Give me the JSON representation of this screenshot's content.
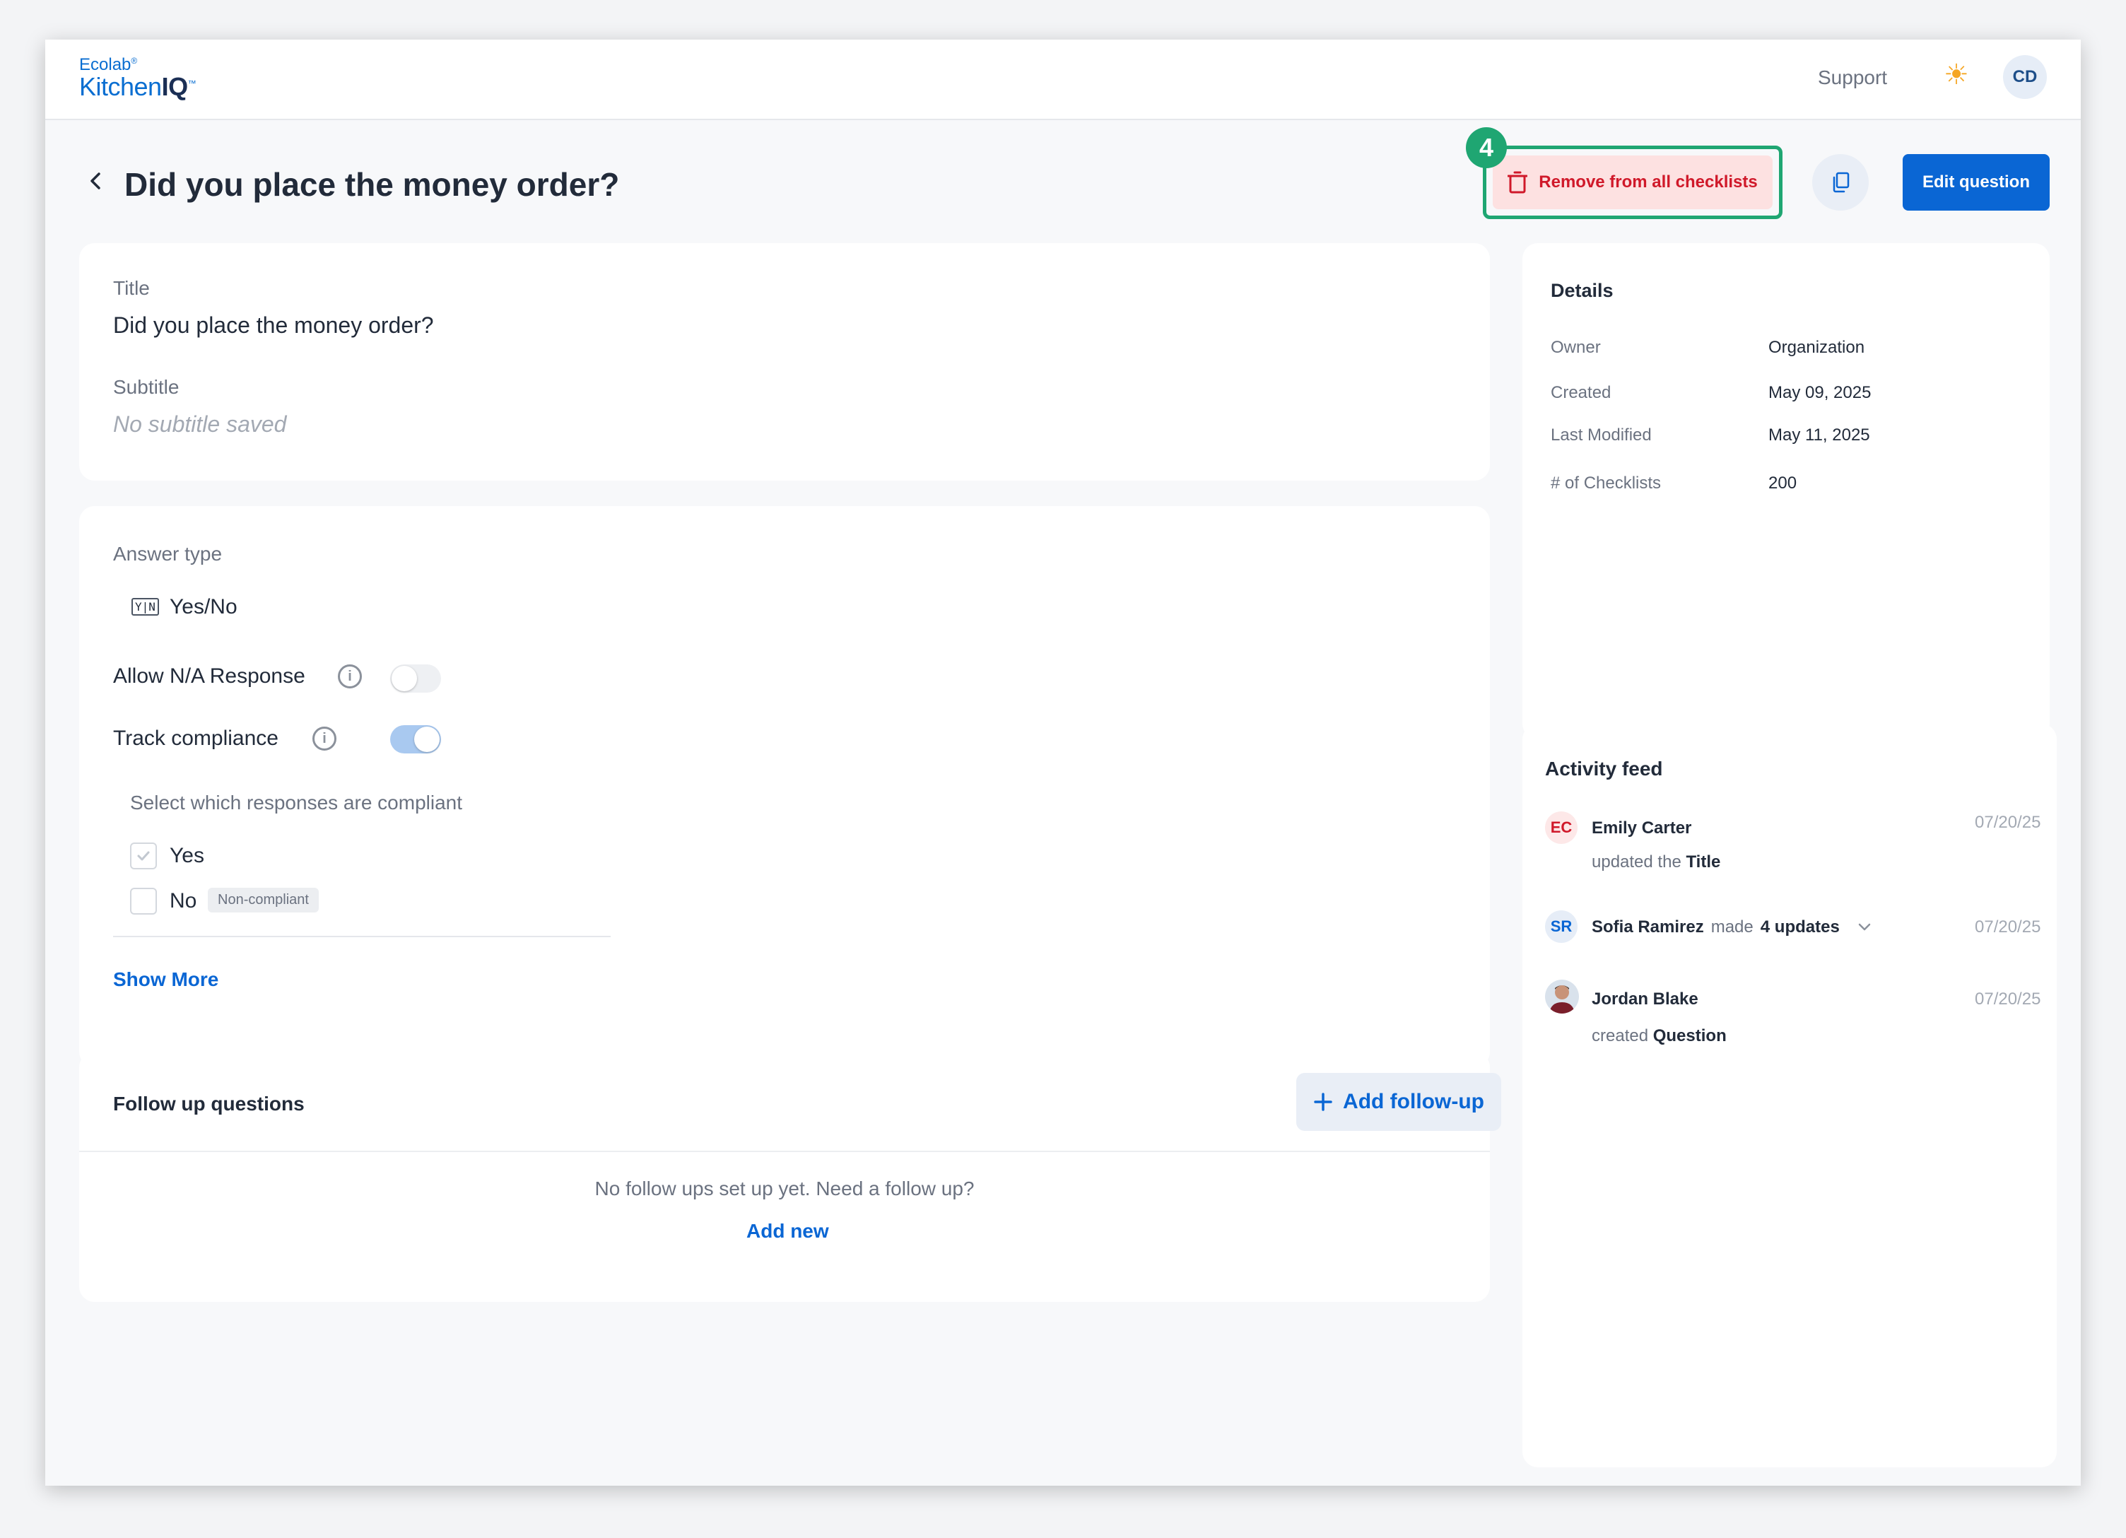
{
  "app": {
    "brand_small": "Ecolab",
    "brand_trademark_small": "®",
    "brand_light": "Kitchen",
    "brand_bold": "IQ",
    "brand_trademark": "™"
  },
  "header": {
    "support_label": "Support",
    "theme_icon": "sun-icon",
    "user_initials": "CD"
  },
  "page": {
    "title": "Did you place the money order?",
    "step_number": "4",
    "remove_label": "Remove from all checklists",
    "edit_label": "Edit question",
    "highlight_color": "#1fa672"
  },
  "question_card": {
    "title_label": "Title",
    "title_value": "Did you place the money order?",
    "subtitle_label": "Subtitle",
    "subtitle_placeholder": "No subtitle saved"
  },
  "answer_card": {
    "answer_type_label": "Answer type",
    "answer_type_icon_text": "Y|N",
    "answer_type_value": "Yes/No",
    "allow_na_label": "Allow N/A Response",
    "allow_na_enabled": false,
    "track_compliance_label": "Track compliance",
    "track_compliance_enabled": true,
    "compliant_prompt": "Select which responses are compliant",
    "options": [
      {
        "label": "Yes",
        "checked": true,
        "tag": ""
      },
      {
        "label": "No",
        "checked": false,
        "tag": "Non-compliant"
      }
    ],
    "show_more": "Show More"
  },
  "followup_card": {
    "heading": "Follow up questions",
    "add_button": "Add follow-up",
    "empty_text": "No follow ups set up yet. Need a follow up?",
    "add_new_link": "Add new"
  },
  "details": {
    "heading": "Details",
    "rows": [
      {
        "key": "Owner",
        "value": "Organization"
      },
      {
        "key": "Created",
        "value": "May 09, 2025"
      },
      {
        "key": "Last Modified",
        "value": "May 11, 2025"
      },
      {
        "key": "# of Checklists",
        "value": "200"
      }
    ]
  },
  "activity": {
    "heading": "Activity feed",
    "items": [
      {
        "initials": "EC",
        "name": "Emily Carter",
        "action_prefix": "updated the ",
        "action_bold": "Title",
        "date": "07/20/25"
      },
      {
        "initials": "SR",
        "name": "Sofia Ramirez",
        "made": "made",
        "count": "4 updates",
        "date": "07/20/25"
      },
      {
        "initials": "",
        "name": "Jordan Blake",
        "action_prefix": "created ",
        "action_bold": "Question",
        "date": "07/20/25"
      }
    ]
  }
}
